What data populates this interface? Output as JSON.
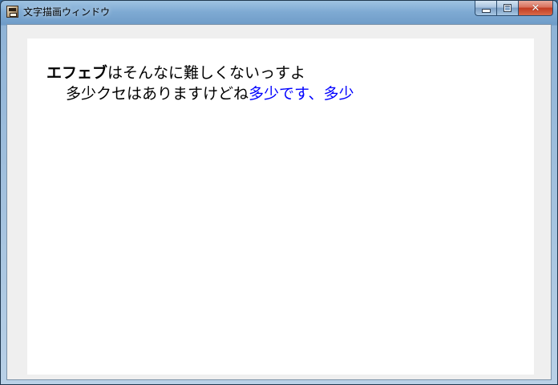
{
  "window": {
    "title": "文字描画ウィンドウ",
    "icon": "app-icon",
    "buttons": {
      "minimize": "minimize-icon",
      "maximize": "maximize-icon",
      "close": "close-icon"
    }
  },
  "content": {
    "line1": {
      "bold": "エフェブ",
      "normal": "はそんなに難しくないっすよ"
    },
    "line2": {
      "normal": "多少クセはありますけどね",
      "blue": "多少です、多少"
    }
  },
  "colors": {
    "text": "#000000",
    "blue_text": "#0000ff",
    "client_background": "#ffffff",
    "frame_background": "#efefef"
  }
}
